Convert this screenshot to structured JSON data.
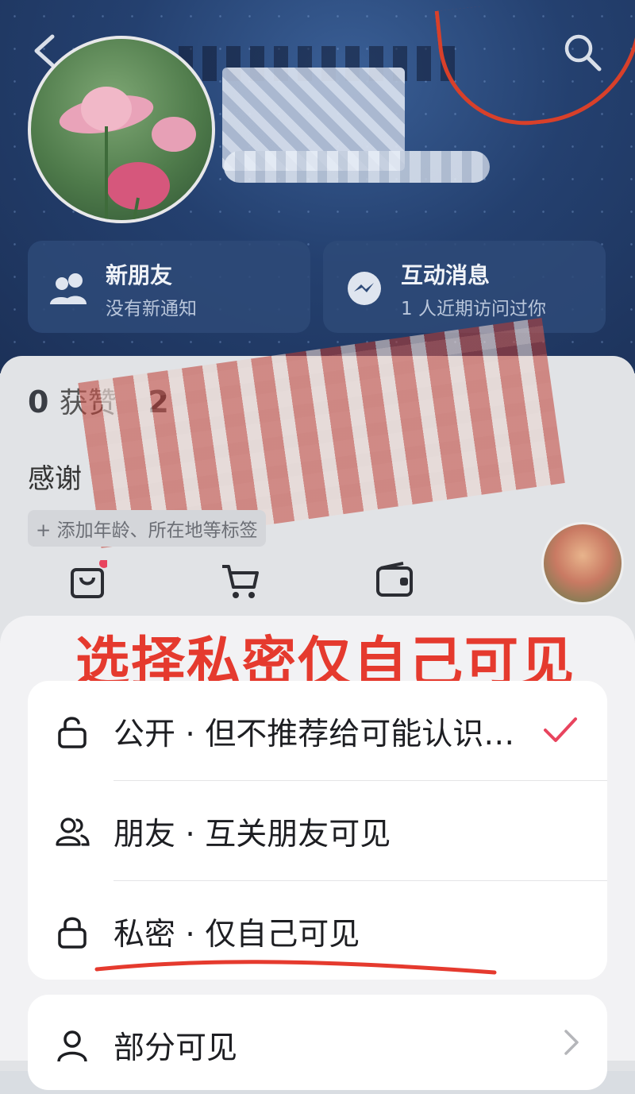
{
  "header": {
    "back_icon": "chevron-left-icon",
    "search_icon": "search-icon"
  },
  "cards": [
    {
      "title": "新朋友",
      "subtitle": "没有新通知",
      "icon": "users-icon"
    },
    {
      "title": "互动消息",
      "subtitle": "1 人近期访问过你",
      "icon": "messenger-icon"
    }
  ],
  "stats": {
    "likes_count": "0",
    "likes_label": "获赞",
    "second_count": "2"
  },
  "bio_prefix": "感谢",
  "tag_chip": "+ 添加年龄、所在地等标签",
  "annotation": {
    "title": "选择私密仅自己可见",
    "color": "#e53a2e"
  },
  "visibility_options": [
    {
      "label": "公开 · 但不推荐给可能认识…",
      "icon": "unlock-icon",
      "selected": true
    },
    {
      "label": "朋友 · 互关朋友可见",
      "icon": "friends-icon",
      "selected": false
    },
    {
      "label": "私密 · 仅自己可见",
      "icon": "lock-icon",
      "selected": false
    }
  ],
  "partial_option": {
    "label": "部分可见",
    "icon": "person-icon"
  },
  "colors": {
    "accent_check": "#e8445e",
    "annotation_red": "#e53a2e"
  }
}
